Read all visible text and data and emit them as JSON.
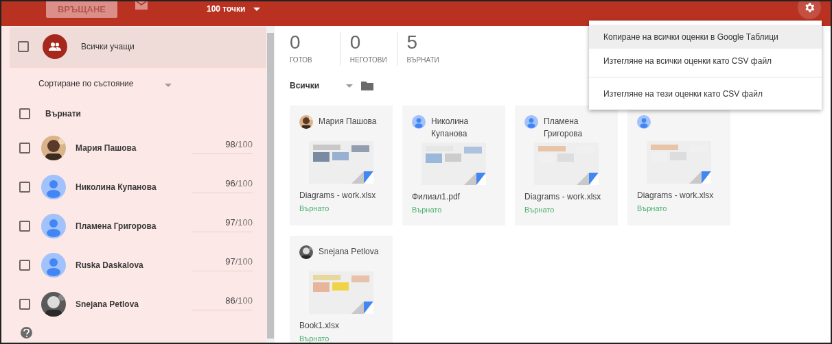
{
  "top_bar": {
    "return_button": {
      "label": "ВРЪЩАНЕ",
      "disabled": true
    },
    "points": "100 точки"
  },
  "sidebar": {
    "all_students": {
      "label": "Всички учащи",
      "checked": false
    },
    "sort": "Сортиране по състояние",
    "group": {
      "label": "Върнати",
      "checked": false
    },
    "students": [
      {
        "name": "Мария Пашова",
        "grade": "98",
        "total": "/100",
        "checked": false
      },
      {
        "name": "Николина Купанова",
        "kind": "generic",
        "grade": "96",
        "total": "/100",
        "checked": false
      },
      {
        "name": "Пламена Григорова",
        "kind": "generic",
        "grade": "97",
        "total": "/100",
        "checked": false
      },
      {
        "name": "Ruska Daskalova",
        "kind": "generic",
        "grade": "97",
        "total": "/100",
        "checked": false
      },
      {
        "name": "Snejana Petlova",
        "grade": "86",
        "total": "/100",
        "checked": false
      }
    ]
  },
  "stats": [
    {
      "value": "0",
      "label": "ГОТОВ"
    },
    {
      "value": "0",
      "label": "НЕГОТОВИ"
    },
    {
      "value": "5",
      "label": "ВЪРНАТИ"
    }
  ],
  "filter": "Всички",
  "cards": [
    {
      "student": "Мария Пашова",
      "file": "Diagrams - work.xlsx",
      "status": "Върнато"
    },
    {
      "student": "Николина Купанова",
      "kind": "generic",
      "file": "Филиал1.pdf",
      "status": "Върнато"
    },
    {
      "student": "Пламена Григорова",
      "kind": "generic",
      "file": "Diagrams - work.xlsx",
      "status": "Върнато"
    },
    {
      "kind": "generic",
      "file": "Diagrams - work.xlsx",
      "status": "Върнато"
    },
    {
      "student": "Snejana Petlova",
      "file": "Book1.xlsx",
      "status": "Върнато"
    }
  ],
  "menu": {
    "groups": [
      [
        {
          "label": "Копиране на всички оценки в Google Таблици",
          "selected": true
        },
        {
          "label": "Изтегляне на всички оценки като CSV файл",
          "selected": false
        }
      ],
      [
        {
          "label": "Изтегляне на тези оценки като CSV файл",
          "selected": false
        }
      ]
    ]
  }
}
